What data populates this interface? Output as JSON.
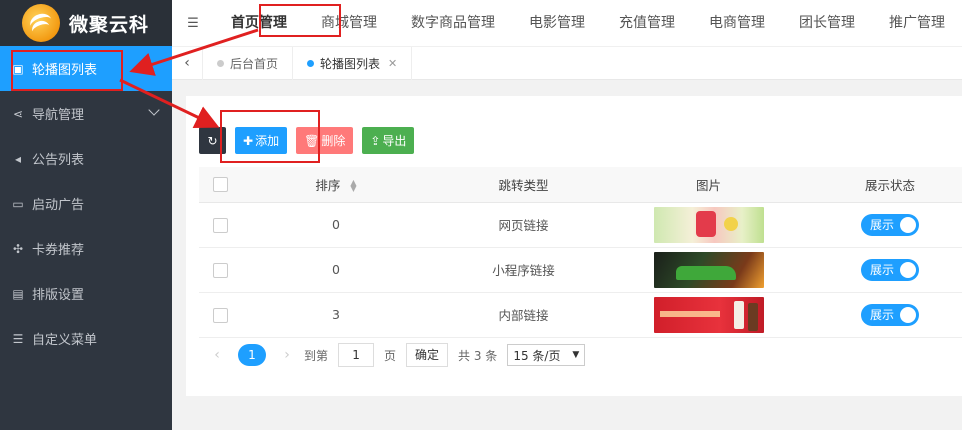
{
  "app": {
    "name": "微聚云科"
  },
  "sidebar": {
    "items": [
      {
        "label": "轮播图列表",
        "icon": "image-icon",
        "glyph": "▣"
      },
      {
        "label": "导航管理",
        "icon": "share-icon",
        "glyph": "⋖"
      },
      {
        "label": "公告列表",
        "icon": "bullhorn-icon",
        "glyph": "◂"
      },
      {
        "label": "启动广告",
        "icon": "monitor-icon",
        "glyph": "▭"
      },
      {
        "label": "卡券推荐",
        "icon": "cubes-icon",
        "glyph": "✣"
      },
      {
        "label": "排版设置",
        "icon": "file-icon",
        "glyph": "▤"
      },
      {
        "label": "自定义菜单",
        "icon": "list-icon",
        "glyph": "☰"
      }
    ]
  },
  "topnav": {
    "items": [
      "首页管理",
      "商城管理",
      "数字商品管理",
      "电影管理",
      "充值管理",
      "电商管理",
      "团长管理",
      "推广管理"
    ]
  },
  "tabs": {
    "items": [
      {
        "label": "后台首页"
      },
      {
        "label": "轮播图列表",
        "close": "✕"
      }
    ]
  },
  "toolbar": {
    "refresh_glyph": "↻",
    "add_label": "添加",
    "add_glyph": "✚",
    "delete_label": "删除",
    "delete_glyph": "🗑",
    "export_label": "导出",
    "export_glyph": "⇪"
  },
  "table": {
    "headers": {
      "sort": "排序",
      "jump_type": "跳转类型",
      "image": "图片",
      "status": "展示状态"
    },
    "rows": [
      {
        "sort": "0",
        "jump_type": "网页链接",
        "status": "展示"
      },
      {
        "sort": "0",
        "jump_type": "小程序链接",
        "status": "展示"
      },
      {
        "sort": "3",
        "jump_type": "内部链接",
        "status": "展示"
      }
    ]
  },
  "pager": {
    "current": "1",
    "goto_label": "到第",
    "page_value": "1",
    "page_unit": "页",
    "confirm_label": "确定",
    "total_label": "共 3 条",
    "page_size": "15 条/页"
  },
  "colors": {
    "accent": "#1e9fff",
    "sidebar_bg": "#2f3640",
    "annotation_red": "#e02020"
  }
}
